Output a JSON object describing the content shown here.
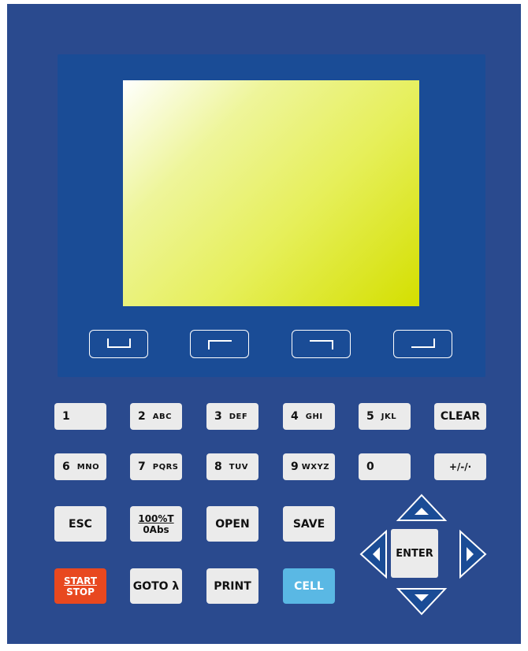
{
  "softkeys": [
    {
      "name": "softkey-1",
      "glyph": "b"
    },
    {
      "name": "softkey-2",
      "glyph": "tl"
    },
    {
      "name": "softkey-3",
      "glyph": "tr"
    },
    {
      "name": "softkey-4",
      "glyph": "br"
    }
  ],
  "keypad": {
    "row1": [
      {
        "digit": "1",
        "letters": ""
      },
      {
        "digit": "2",
        "letters": "ABC"
      },
      {
        "digit": "3",
        "letters": "DEF"
      },
      {
        "digit": "4",
        "letters": "GHI"
      },
      {
        "digit": "5",
        "letters": "JKL"
      },
      {
        "label": "CLEAR"
      }
    ],
    "row2": [
      {
        "digit": "6",
        "letters": "MNO"
      },
      {
        "digit": "7",
        "letters": "PQRS"
      },
      {
        "digit": "8",
        "letters": "TUV"
      },
      {
        "digit": "9",
        "letters": "WXYZ"
      },
      {
        "digit": "0",
        "letters": ""
      },
      {
        "label": "+/-/·"
      }
    ],
    "esc": "ESC",
    "t_top": "100%T",
    "t_bottom": "0Abs",
    "open": "OPEN",
    "save": "SAVE",
    "start_top": "START",
    "start_bottom": "STOP",
    "goto": "GOTO λ",
    "print": "PRINT",
    "cell": "CELL",
    "enter": "ENTER"
  },
  "colors": {
    "panel": "#2a4a8e",
    "bezel": "#1a4c96",
    "key": "#ebebeb",
    "start": "#e8481f",
    "cell": "#5ab8e4"
  }
}
